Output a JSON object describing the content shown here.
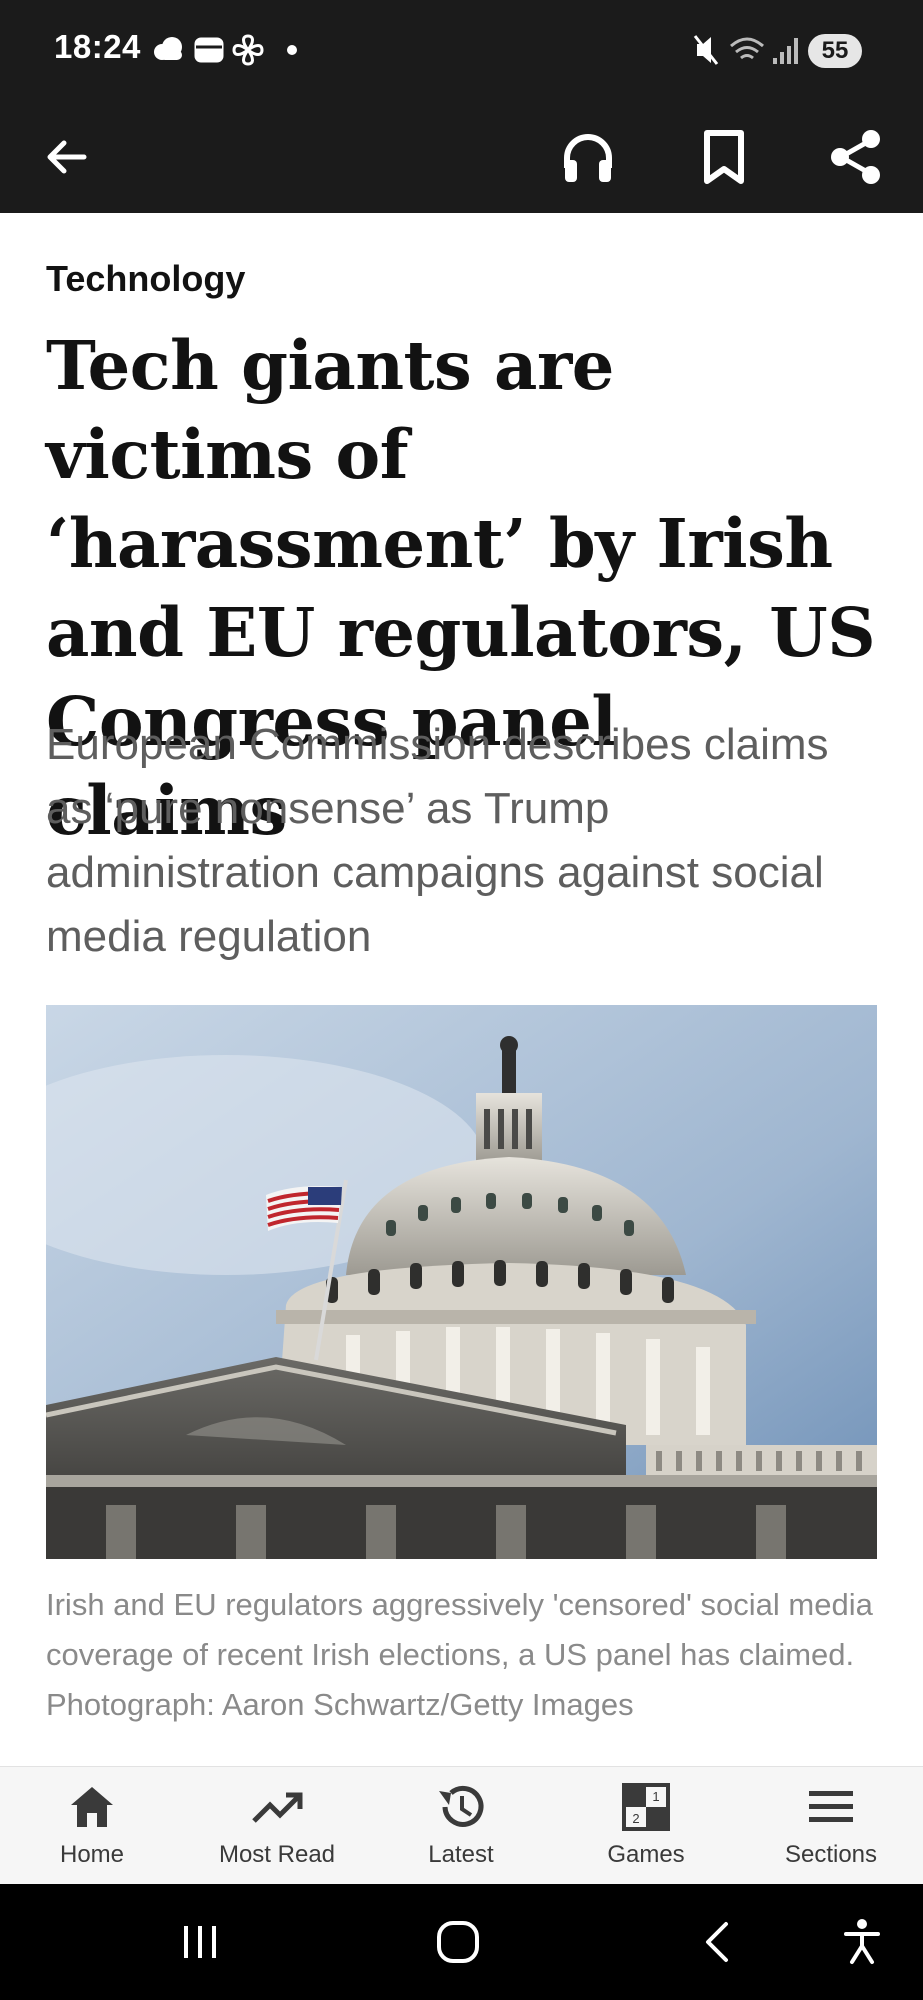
{
  "status_bar": {
    "time": "18:24",
    "battery": "55",
    "left_icons": [
      "weather-icon",
      "wallet-icon",
      "pinwheel-icon",
      "dot-icon"
    ],
    "right_icons": [
      "mute-icon",
      "wifi-icon",
      "signal-icon"
    ]
  },
  "app_bar": {
    "icons": [
      "back-arrow-icon",
      "headphones-icon",
      "bookmark-icon",
      "share-icon"
    ]
  },
  "article": {
    "section": "Technology",
    "headline": "Tech giants are victims of ‘harassment’ by Irish and EU regulators, US Congress panel claims",
    "standfirst": "European Commission describes claims as ‘pure nonsense’ as Trump administration campaigns against social media regulation",
    "caption": "Irish and EU regulators aggressively 'censored' social media coverage of recent Irish elections, a US panel has claimed. Photograph: Aaron Schwartz/Getty Images"
  },
  "bottom_nav": {
    "items": [
      {
        "label": "Home",
        "icon": "home-icon"
      },
      {
        "label": "Most Read",
        "icon": "trending-icon"
      },
      {
        "label": "Latest",
        "icon": "history-icon"
      },
      {
        "label": "Games",
        "icon": "games-icon"
      },
      {
        "label": "Sections",
        "icon": "menu-icon"
      }
    ]
  },
  "system_nav": {
    "icons": [
      "recents-icon",
      "home-circle-icon",
      "back-chevron-icon",
      "accessibility-icon"
    ]
  },
  "colors": {
    "bar_background": "#1b1b1b",
    "headline": "#121212",
    "standfirst": "#5e5e5e",
    "caption": "#8a8a8a",
    "nav_background": "#f6f6f6"
  }
}
